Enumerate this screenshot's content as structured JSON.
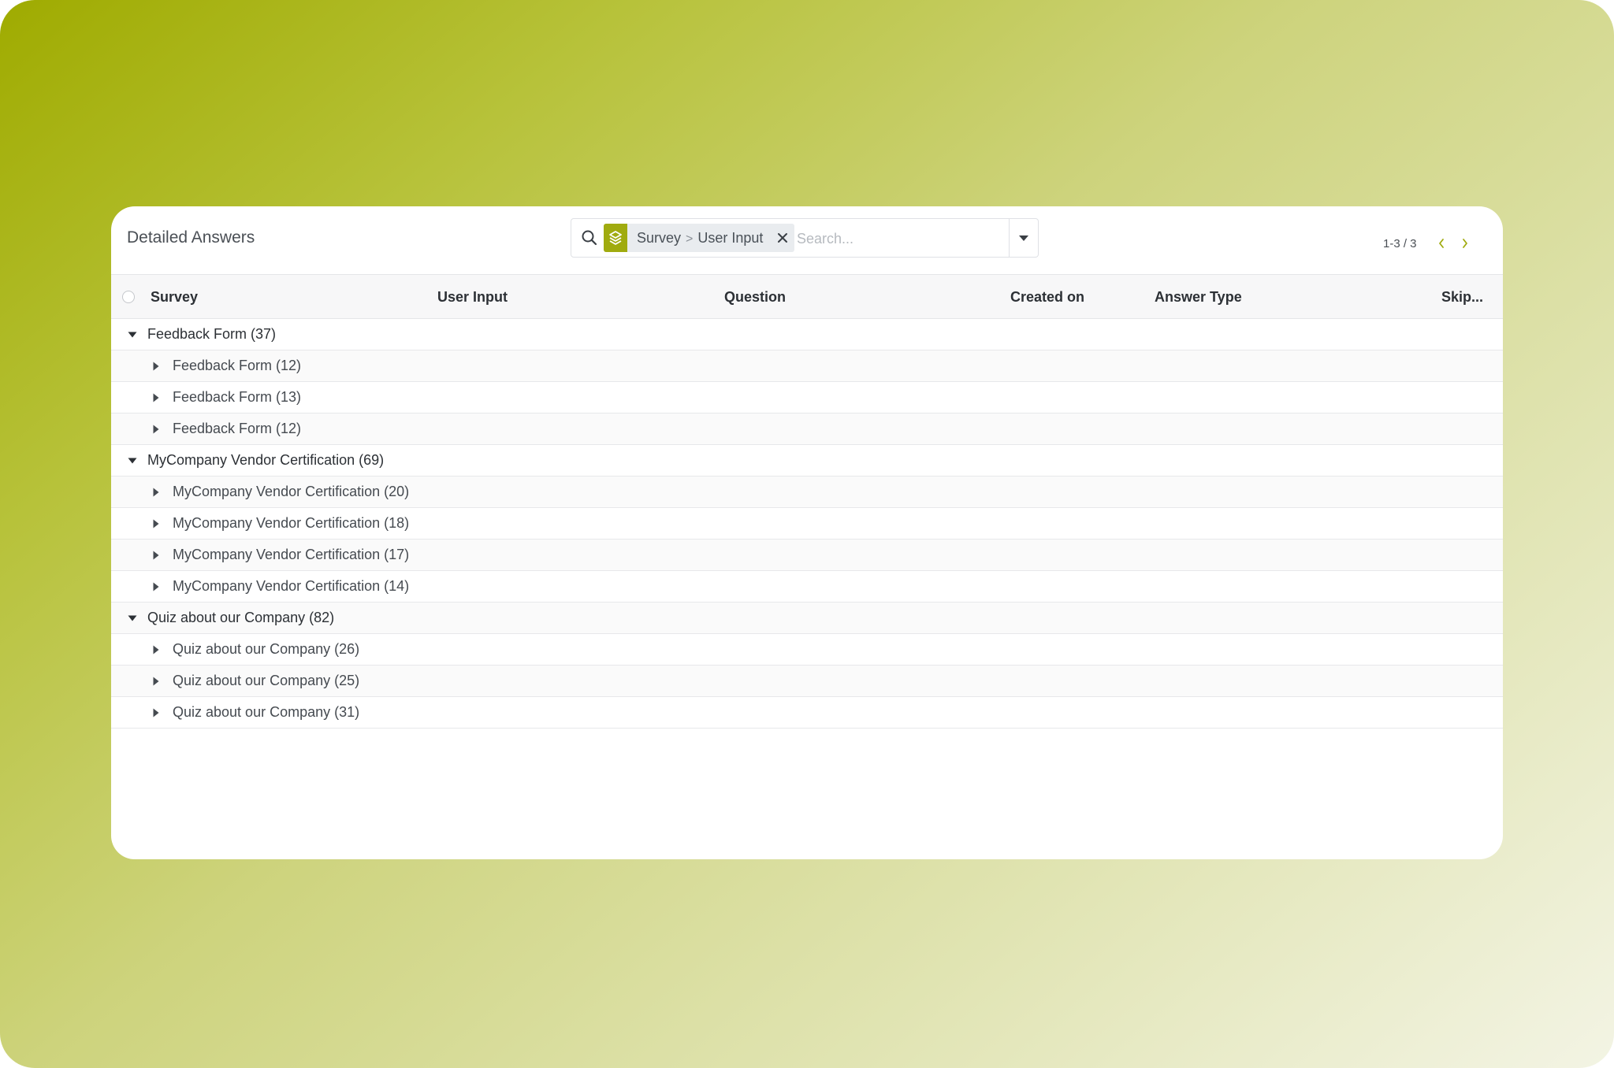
{
  "page": {
    "title": "Detailed Answers"
  },
  "search": {
    "facet": {
      "icon": "layers-icon",
      "values": [
        "Survey",
        "User Input"
      ],
      "separator": ">"
    },
    "placeholder": "Search..."
  },
  "pager": {
    "value": "1-3 / 3"
  },
  "columns": [
    {
      "label": "Survey"
    },
    {
      "label": "User Input"
    },
    {
      "label": "Question"
    },
    {
      "label": "Created on"
    },
    {
      "label": "Answer Type"
    },
    {
      "label": "Skip..."
    }
  ],
  "groups": [
    {
      "label": "Feedback Form (37)",
      "expanded": true,
      "children": [
        {
          "label": "Feedback Form (12)"
        },
        {
          "label": "Feedback Form (13)"
        },
        {
          "label": "Feedback Form (12)"
        }
      ]
    },
    {
      "label": "MyCompany Vendor Certification (69)",
      "expanded": true,
      "children": [
        {
          "label": "MyCompany Vendor Certification (20)"
        },
        {
          "label": "MyCompany Vendor Certification (18)"
        },
        {
          "label": "MyCompany Vendor Certification (17)"
        },
        {
          "label": "MyCompany Vendor Certification (14)"
        }
      ]
    },
    {
      "label": "Quiz about our Company (82)",
      "expanded": true,
      "children": [
        {
          "label": "Quiz about our Company (26)"
        },
        {
          "label": "Quiz about our Company (25)"
        },
        {
          "label": "Quiz about our Company (31)"
        }
      ]
    }
  ],
  "colors": {
    "accent": "#a0ab0f",
    "text": "#2c3035"
  }
}
